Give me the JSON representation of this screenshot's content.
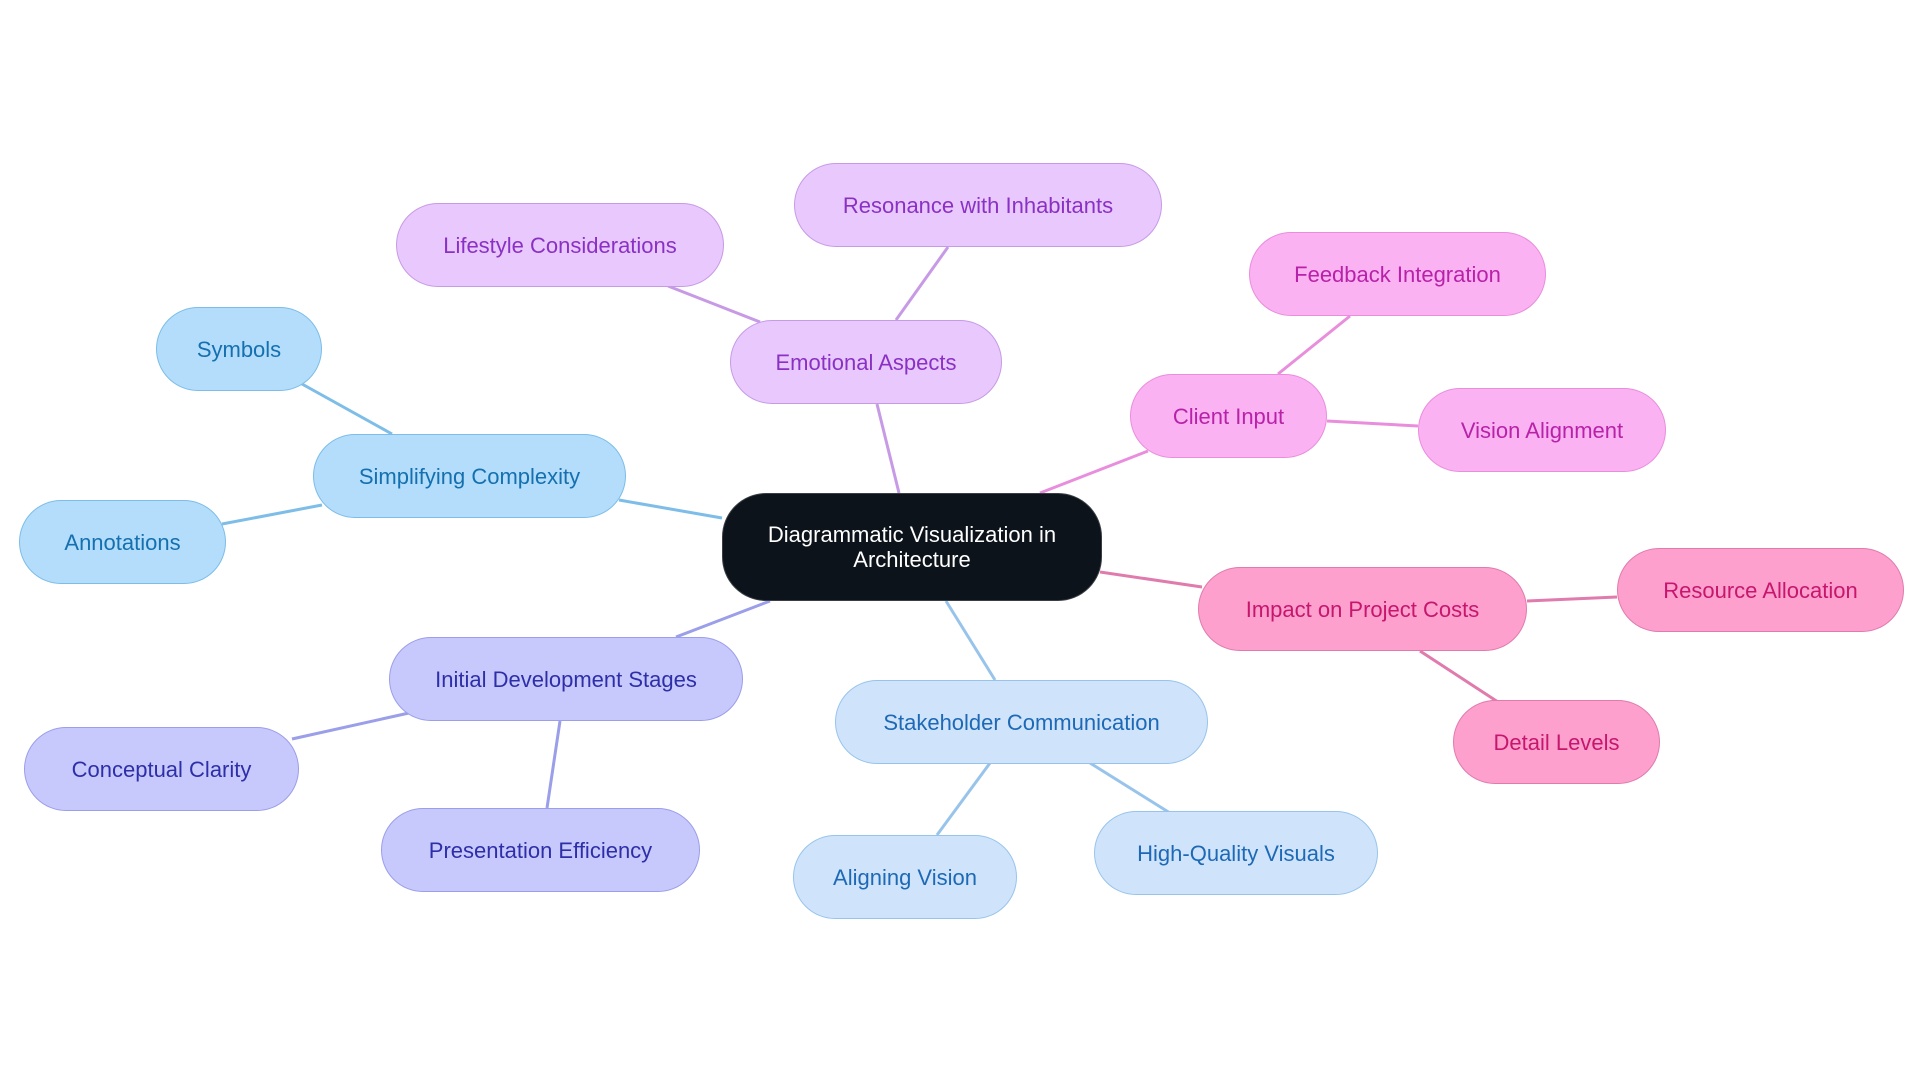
{
  "diagram": {
    "type": "mind-map",
    "root": {
      "id": "root",
      "label": "Diagrammatic Visualization in Architecture",
      "theme": "root"
    },
    "branches": [
      {
        "id": "simplifying",
        "label": "Simplifying Complexity",
        "theme": "blue",
        "children": [
          {
            "id": "symbols",
            "label": "Symbols"
          },
          {
            "id": "annotations",
            "label": "Annotations"
          }
        ]
      },
      {
        "id": "emotional",
        "label": "Emotional Aspects",
        "theme": "purple",
        "children": [
          {
            "id": "lifestyle",
            "label": "Lifestyle Considerations"
          },
          {
            "id": "resonance",
            "label": "Resonance with Inhabitants"
          }
        ]
      },
      {
        "id": "client",
        "label": "Client Input",
        "theme": "pink",
        "children": [
          {
            "id": "feedback",
            "label": "Feedback Integration"
          },
          {
            "id": "vision_alignment",
            "label": "Vision Alignment"
          }
        ]
      },
      {
        "id": "costs",
        "label": "Impact on Project Costs",
        "theme": "rose",
        "children": [
          {
            "id": "resource",
            "label": "Resource Allocation"
          },
          {
            "id": "detail",
            "label": "Detail Levels"
          }
        ]
      },
      {
        "id": "stakeholder",
        "label": "Stakeholder Communication",
        "theme": "lblue",
        "children": [
          {
            "id": "aligning",
            "label": "Aligning Vision"
          },
          {
            "id": "hq_visuals",
            "label": "High-Quality Visuals"
          }
        ]
      },
      {
        "id": "initial",
        "label": "Initial Development Stages",
        "theme": "indigo",
        "children": [
          {
            "id": "conceptual",
            "label": "Conceptual Clarity"
          },
          {
            "id": "presentation",
            "label": "Presentation Efficiency"
          }
        ]
      }
    ],
    "colors": {
      "blue": {
        "fill": "#b3ddfb",
        "stroke": "#7dbde8",
        "text": "#1570b0",
        "edge": "#7dbde8"
      },
      "purple": {
        "fill": "#e9c8fd",
        "stroke": "#c79ae6",
        "text": "#8a31c4",
        "edge": "#c79ae6"
      },
      "pink": {
        "fill": "#fbb2f3",
        "stroke": "#e98ddd",
        "text": "#b822a8",
        "edge": "#e98ddd"
      },
      "rose": {
        "fill": "#fda0ce",
        "stroke": "#e07bad",
        "text": "#c6166d",
        "edge": "#e07bad"
      },
      "lblue": {
        "fill": "#cfe4fb",
        "stroke": "#98c4ec",
        "text": "#1d69b6",
        "edge": "#98c4ec"
      },
      "indigo": {
        "fill": "#c7c9fd",
        "stroke": "#9b9ee8",
        "text": "#2e2fa8",
        "edge": "#9b9ee8"
      },
      "root": {
        "fill": "#0c131a",
        "stroke": "#3a3f45",
        "text": "#ffffff"
      }
    }
  }
}
